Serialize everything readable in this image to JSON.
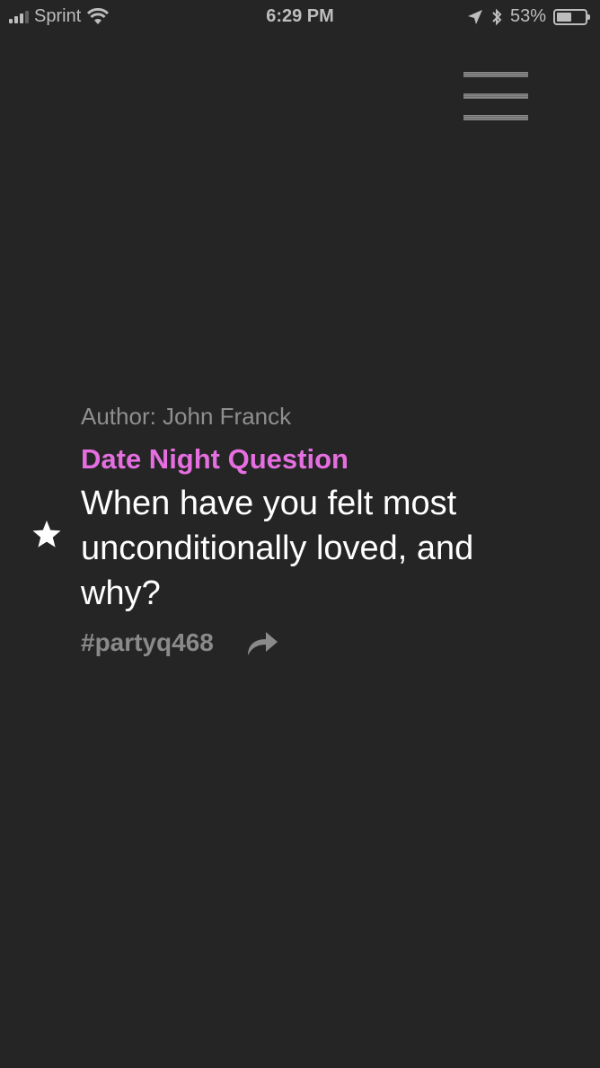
{
  "status_bar": {
    "carrier": "Sprint",
    "time": "6:29 PM",
    "battery_percent": "53%",
    "battery_level": 0.53,
    "signal_bars_active": 3,
    "icons": [
      "signal-icon",
      "wifi-icon",
      "location-arrow-icon",
      "bluetooth-icon",
      "battery-icon"
    ]
  },
  "menu": {
    "icon": "hamburger-menu-icon"
  },
  "card": {
    "author": "Author: John Franck",
    "category": "Date Night Question",
    "question": "When have you felt most unconditionally loved, and why?",
    "tag": "#partyq468",
    "favorite_icon": "star-icon",
    "share_icon": "share-arrow-icon"
  },
  "colors": {
    "background": "#252525",
    "accent": "#e56ee0",
    "muted_text": "#8f8f8f",
    "primary_text": "#ffffff"
  }
}
